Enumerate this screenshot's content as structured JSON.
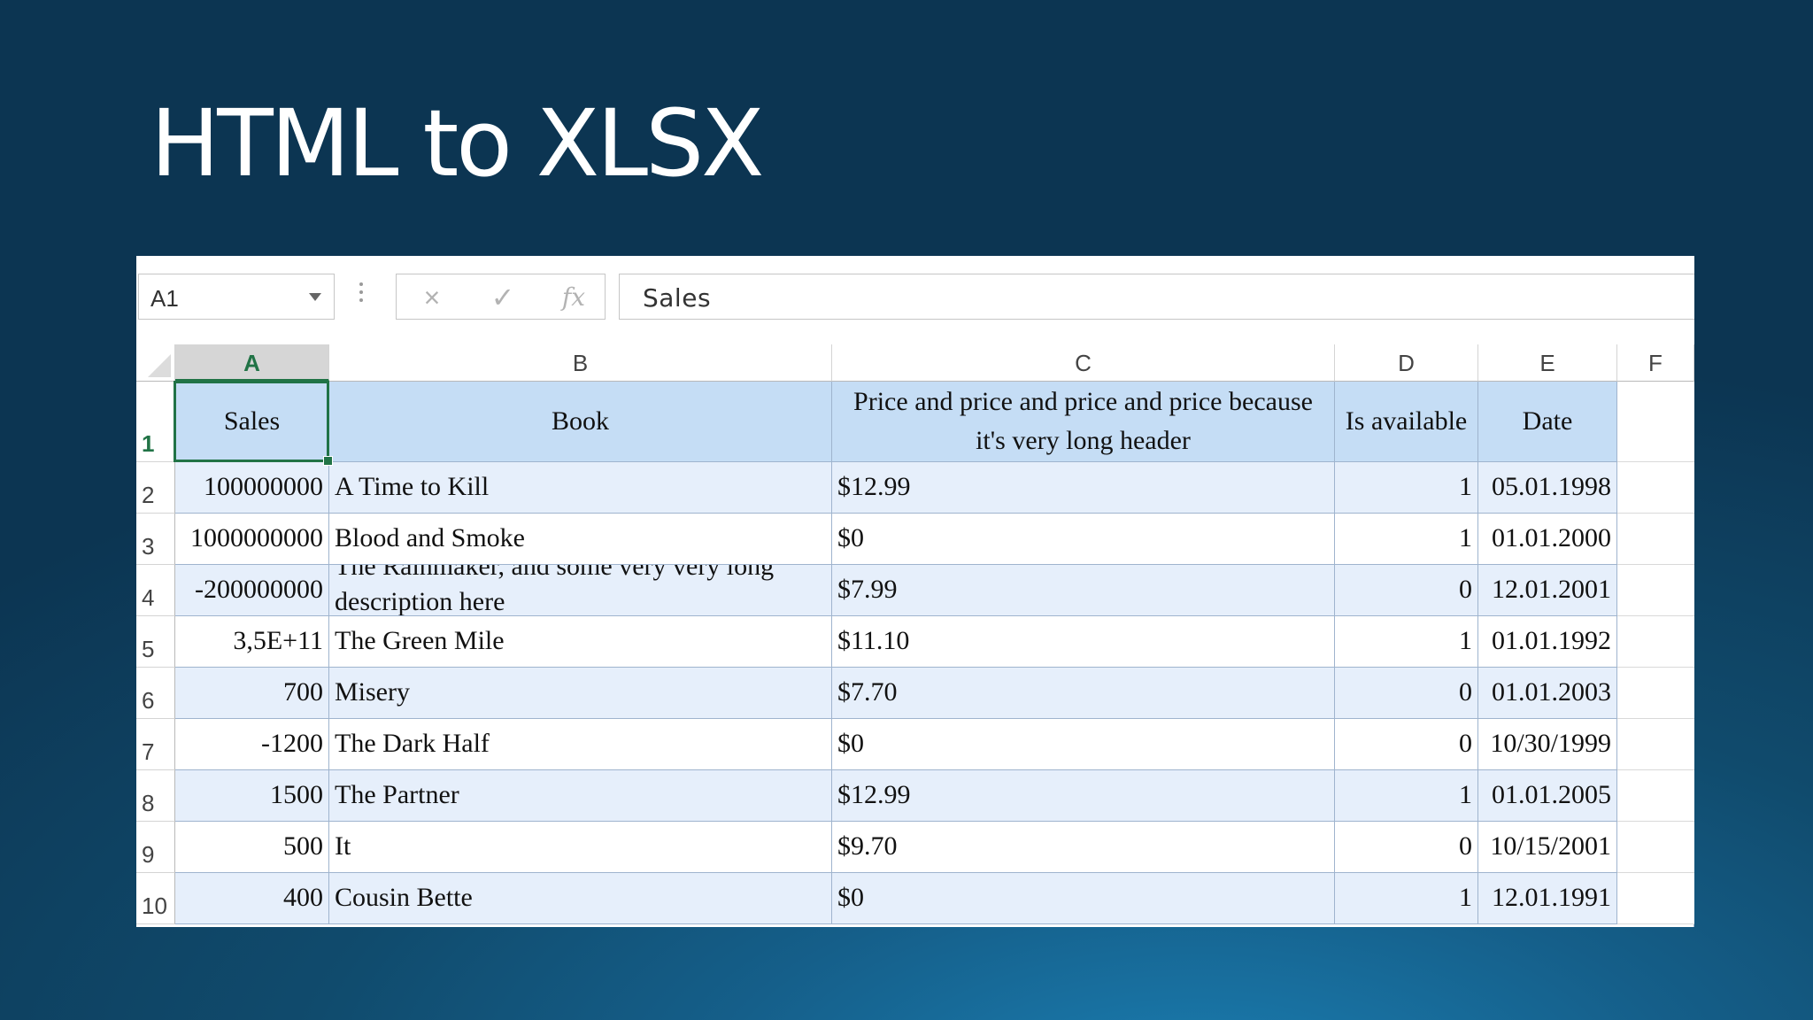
{
  "slide": {
    "title": "HTML to XLSX"
  },
  "name_box": {
    "value": "A1"
  },
  "formula_bar": {
    "cancel_icon": "×",
    "enter_icon": "✓",
    "insert_function_icon": "fx",
    "value": "Sales"
  },
  "columns": [
    "A",
    "B",
    "C",
    "D",
    "E",
    "F"
  ],
  "row_numbers": [
    "1",
    "2",
    "3",
    "4",
    "5",
    "6",
    "7",
    "8",
    "9",
    "10"
  ],
  "headers": {
    "sales": "Sales",
    "book": "Book",
    "price": "Price and price and price and price because it's very long header",
    "available": "Is available",
    "date": "Date"
  },
  "rows": [
    {
      "sales": "100000000",
      "book": "A Time to Kill",
      "price": "$12.99",
      "available": "1",
      "date": "05.01.1998"
    },
    {
      "sales": "1000000000",
      "book": "Blood and Smoke",
      "price": "$0",
      "available": "1",
      "date": "01.01.2000"
    },
    {
      "sales": "-200000000",
      "book": "The Rainmaker, and some very very long description here",
      "price": "$7.99",
      "available": "0",
      "date": "12.01.2001"
    },
    {
      "sales": "3,5E+11",
      "book": "The Green Mile",
      "price": "$11.10",
      "available": "1",
      "date": "01.01.1992"
    },
    {
      "sales": "700",
      "book": "Misery",
      "price": "$7.70",
      "available": "0",
      "date": "01.01.2003"
    },
    {
      "sales": "-1200",
      "book": "The Dark Half",
      "price": "$0",
      "available": "0",
      "date": "10/30/1999"
    },
    {
      "sales": "1500",
      "book": "The Partner",
      "price": "$12.99",
      "available": "1",
      "date": "01.01.2005"
    },
    {
      "sales": "500",
      "book": "It",
      "price": "$9.70",
      "available": "0",
      "date": "10/15/2001"
    },
    {
      "sales": "400",
      "book": "Cousin Bette",
      "price": "$0",
      "available": "1",
      "date": "12.01.1991"
    }
  ]
}
